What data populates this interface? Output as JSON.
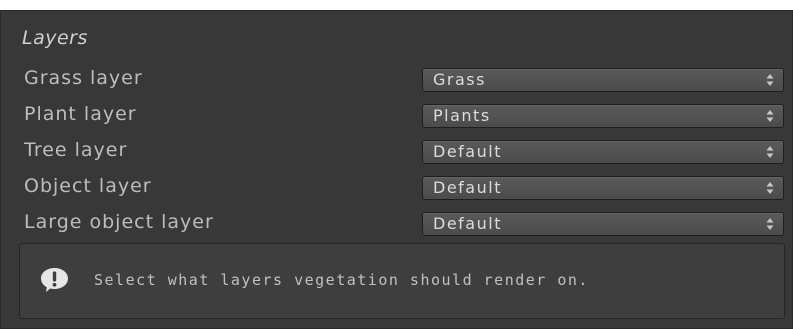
{
  "section": {
    "title": "Layers"
  },
  "rows": [
    {
      "label": "Grass layer",
      "value": "Grass"
    },
    {
      "label": "Plant layer",
      "value": "Plants"
    },
    {
      "label": "Tree layer",
      "value": "Default"
    },
    {
      "label": "Object layer",
      "value": "Default"
    },
    {
      "label": "Large object layer",
      "value": "Default"
    }
  ],
  "help": {
    "icon": "exclamation-info-icon",
    "text": "Select what layers vegetation should render on."
  },
  "colors": {
    "panel_background": "#383838",
    "dropdown_background": "#4f4f4f",
    "text": "#c4c4c4"
  }
}
